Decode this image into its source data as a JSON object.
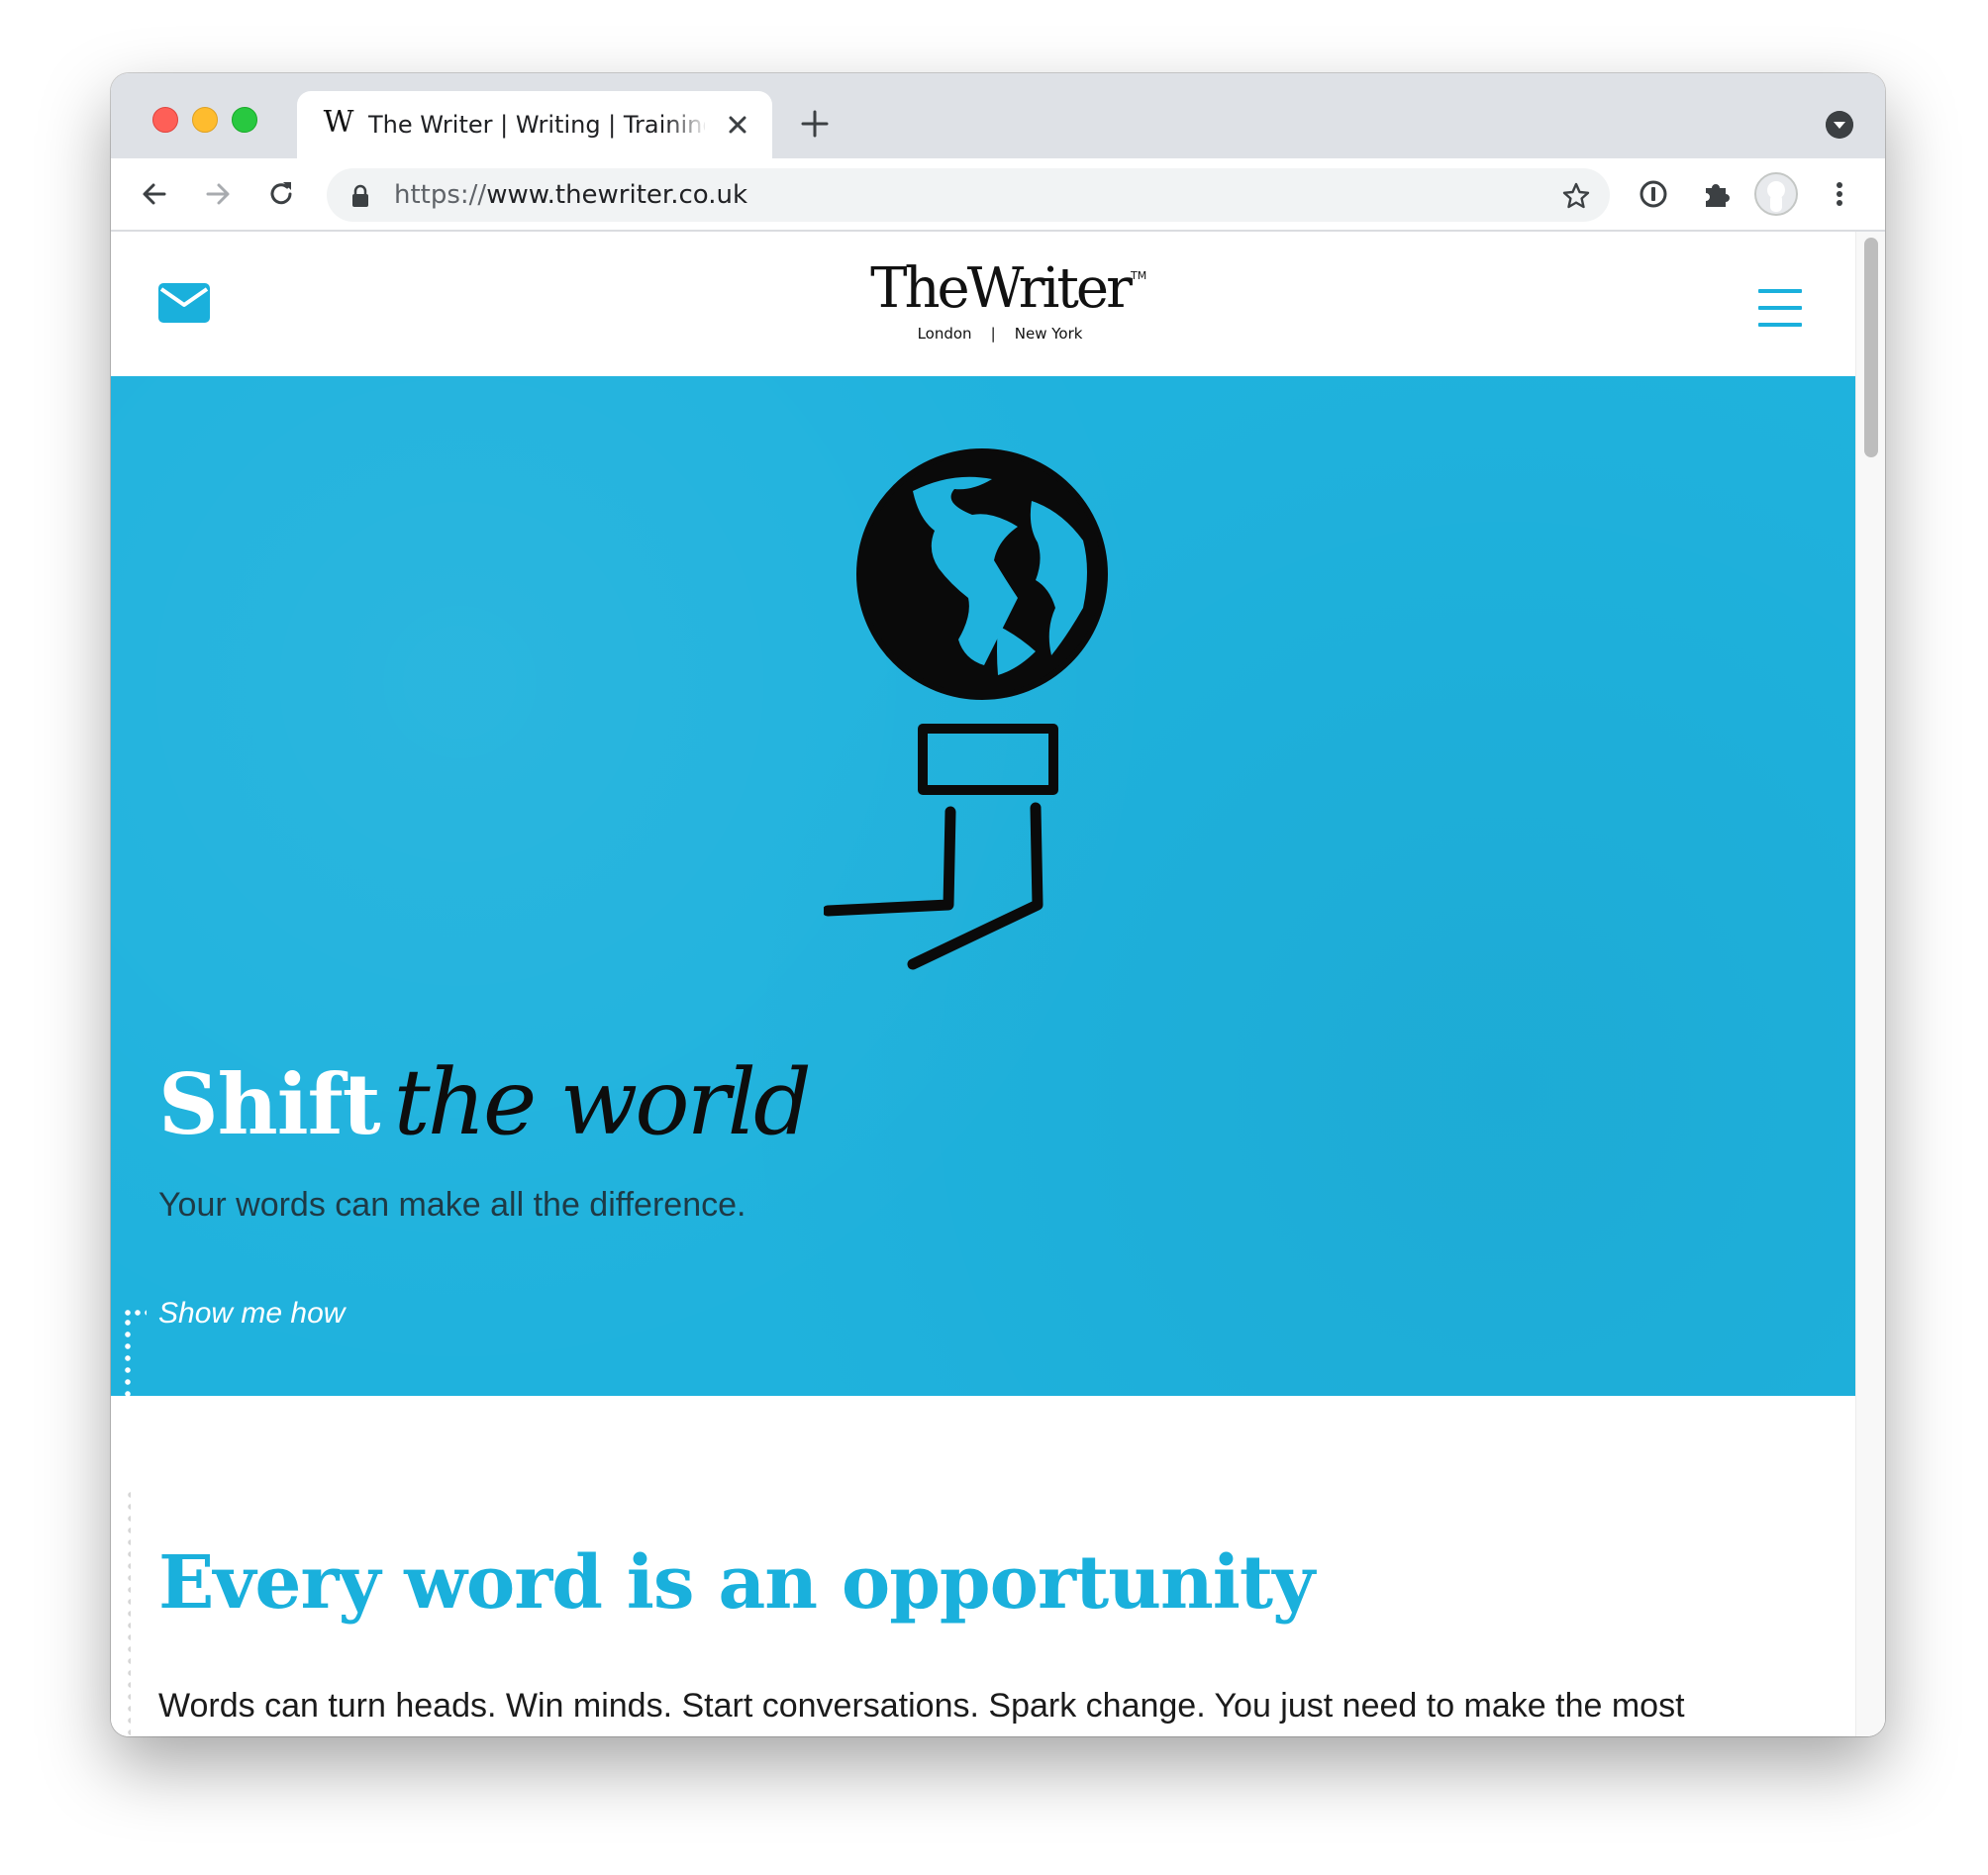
{
  "browser": {
    "tab": {
      "favicon": "W",
      "title": "The Writer | Writing | Training | Consultancy"
    },
    "url": {
      "scheme": "https://",
      "host": "www.thewriter.co.uk"
    },
    "icons": {
      "back": "back-arrow-icon",
      "forward": "forward-arrow-icon",
      "reload": "reload-icon",
      "lock": "lock-icon",
      "star": "bookmark-star-icon",
      "password": "password-manager-icon",
      "extensions": "puzzle-piece-icon",
      "profile": "profile-avatar-icon",
      "menu": "kebab-menu-icon"
    }
  },
  "site": {
    "logo": {
      "text": "TheWriter",
      "tm": "TM",
      "cities": "London    |    New York"
    },
    "hero": {
      "title_bold": "Shift",
      "title_script": "the world",
      "subtitle": "Your words can make all the difference.",
      "cta": "Show me how"
    },
    "section": {
      "heading": "Every word is an opportunity",
      "body": "Words can turn heads. Win minds. Start conversations. Spark change. You just need to make the most"
    }
  },
  "colors": {
    "brand_blue": "#1ab0dc",
    "hero_bg": "#1fb2dd",
    "tabstrip": "#dee1e6"
  }
}
